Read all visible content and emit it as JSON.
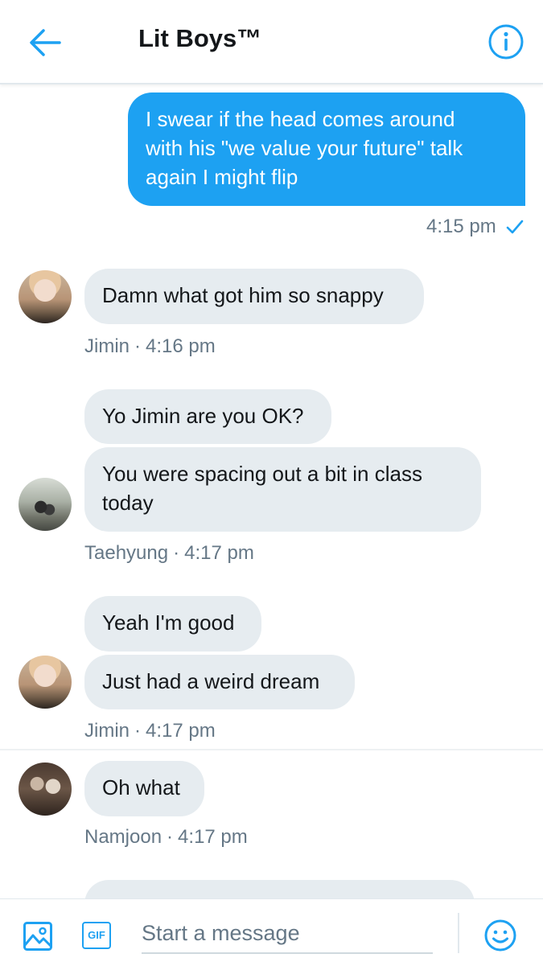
{
  "header": {
    "title": "Lit Boys™",
    "back_icon": "arrow-left-icon",
    "info_icon": "info-icon"
  },
  "messages": [
    {
      "type": "outgoing",
      "text": "I swear if the head comes around\nwith his \"we value your future\" talk\nagain I might flip",
      "time": "4:15 pm",
      "status_icon": "check-icon"
    },
    {
      "type": "incoming",
      "sender": "Jimin",
      "bubbles": [
        "Damn what got him so snappy"
      ],
      "time": "4:16 pm"
    },
    {
      "type": "incoming",
      "sender": "Taehyung",
      "bubbles": [
        "Yo Jimin are you OK?",
        "You were spacing out a bit in class\ntoday"
      ],
      "time": "4:17 pm"
    },
    {
      "type": "incoming",
      "sender": "Jimin",
      "bubbles": [
        "Yeah I'm good",
        "Just had a weird dream"
      ],
      "time": "4:17 pm"
    },
    {
      "type": "incoming",
      "sender": "Namjoon",
      "bubbles": [
        "Oh what"
      ],
      "time": "4:17 pm"
    }
  ],
  "composer": {
    "placeholder": "Start a message",
    "gif_label": "GIF",
    "image_icon": "image-icon",
    "emoji_icon": "smiley-icon"
  },
  "colors": {
    "accent": "#1da1f2",
    "incoming_bubble": "#e6ecf0",
    "meta_text": "#657786"
  }
}
